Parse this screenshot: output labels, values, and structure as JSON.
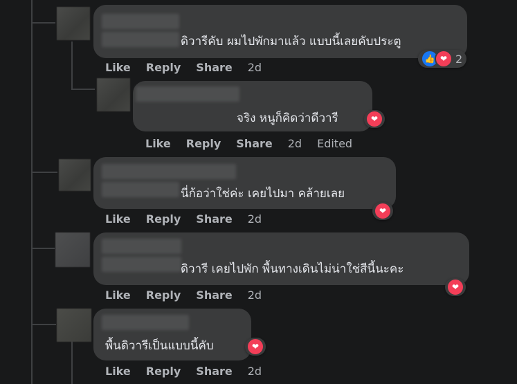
{
  "comments": [
    {
      "text": "ดิวารีคับ ผมไปพักมาแล้ว แบบนี้เลยคับประตู",
      "reactions": {
        "icons": [
          "like-icon",
          "love-icon"
        ],
        "count": "2"
      },
      "time": "2d",
      "edited": ""
    },
    {
      "text": "จริง หนูก็คิดว่าดีวารี",
      "reactions": {
        "icons": [
          "love-icon"
        ],
        "count": ""
      },
      "time": "2d",
      "edited": "Edited"
    },
    {
      "text": "นี่ก้อว่าใช่ค่ะ เคยไปมา คล้ายเลย",
      "reactions": {
        "icons": [
          "love-icon"
        ],
        "count": ""
      },
      "time": "2d",
      "edited": ""
    },
    {
      "text": "ดิวารี เคยไปพัก พื้นทางเดินไม่น่าใช่สีนี้นะคะ",
      "reactions": {
        "icons": [
          "love-icon"
        ],
        "count": ""
      },
      "time": "2d",
      "edited": ""
    },
    {
      "text": "พื้นดิวารีเป็นแบบนี้คับ",
      "reactions": {
        "icons": [
          "love-icon"
        ],
        "count": ""
      },
      "time": "2d",
      "edited": ""
    }
  ],
  "actions": {
    "like": "Like",
    "reply": "Reply",
    "share": "Share"
  }
}
